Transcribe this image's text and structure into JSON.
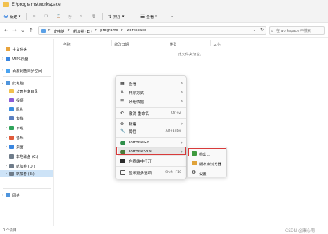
{
  "window": {
    "title": "E:\\programs\\workspace"
  },
  "toolbar": {
    "new_label": "新建",
    "sort_label": "排序",
    "view_label": "查看",
    "more_label": "···"
  },
  "address": {
    "crumbs": [
      "此电脑",
      "新加卷 (E:)",
      "programs",
      "workspace"
    ],
    "separator": ">",
    "search_placeholder": "在 workspace 中搜索"
  },
  "sidebar": {
    "items": [
      {
        "label": "主文件夹",
        "icon": "home-icon",
        "color": "#e8a33c"
      },
      {
        "label": "WPS云盘",
        "icon": "cloud-icon",
        "color": "#3a86e0"
      },
      {
        "label": "百度网盘同步空间",
        "icon": "cloud-icon",
        "color": "#4aa3f0"
      },
      {
        "label": "此电脑",
        "icon": "computer-icon",
        "color": "#4f95dd"
      },
      {
        "label": "公司共享目录",
        "icon": "folder-icon",
        "color": "#f2c14e"
      },
      {
        "label": "视频",
        "icon": "video-icon",
        "color": "#8a5cd6"
      },
      {
        "label": "图片",
        "icon": "picture-icon",
        "color": "#3a8ee0"
      },
      {
        "label": "文档",
        "icon": "document-icon",
        "color": "#5a7fbf"
      },
      {
        "label": "下载",
        "icon": "download-icon",
        "color": "#2fa35a"
      },
      {
        "label": "音乐",
        "icon": "music-icon",
        "color": "#e05a3a"
      },
      {
        "label": "桌面",
        "icon": "desktop-icon",
        "color": "#3a86e0"
      },
      {
        "label": "本地磁盘 (C:)",
        "icon": "drive-icon",
        "color": "#6f7c8a"
      },
      {
        "label": "新加卷 (D:)",
        "icon": "drive-icon",
        "color": "#6f7c8a"
      },
      {
        "label": "新加卷 (E:)",
        "icon": "drive-icon",
        "color": "#6f7c8a"
      },
      {
        "label": "网络",
        "icon": "network-icon",
        "color": "#4f95dd"
      }
    ]
  },
  "content": {
    "columns": [
      "名称",
      "修改日期",
      "类型",
      "大小"
    ],
    "empty_message": "此文件夹为空。"
  },
  "context_menu": {
    "items": [
      {
        "label": "查看",
        "icon": "view-icon",
        "shortcut": "",
        "submenu": true
      },
      {
        "label": "排序方式",
        "icon": "sort-icon",
        "shortcut": "",
        "submenu": true
      },
      {
        "label": "分组依据",
        "icon": "group-icon",
        "shortcut": "",
        "submenu": true
      },
      {
        "label": "撤消 重命名",
        "icon": "undo-icon",
        "shortcut": "Ctrl+Z",
        "submenu": false
      },
      {
        "label": "新建",
        "icon": "new-icon",
        "shortcut": "",
        "submenu": true
      },
      {
        "label": "属性",
        "icon": "properties-icon",
        "shortcut": "Alt+Enter",
        "submenu": false
      },
      {
        "label": "TortoiseGit",
        "icon": "tortoisegit-icon",
        "shortcut": "",
        "submenu": true
      },
      {
        "label": "TortoiseSVN",
        "icon": "tortoisesvn-icon",
        "shortcut": "",
        "submenu": true
      },
      {
        "label": "在终端中打开",
        "icon": "terminal-icon",
        "shortcut": "",
        "submenu": false
      },
      {
        "label": "显示更多选项",
        "icon": "more-options-icon",
        "shortcut": "Shift+F10",
        "submenu": false
      }
    ]
  },
  "svn_submenu": {
    "items": [
      {
        "label": "检出...",
        "icon": "checkout-icon"
      },
      {
        "label": "版本库浏览器",
        "icon": "repo-browser-icon"
      },
      {
        "label": "设置",
        "icon": "settings-icon"
      }
    ]
  },
  "status": {
    "count": "0 个项目",
    "watermark": "CSDN @康心雨"
  },
  "colors": {
    "accent": "#d83a3a",
    "selection": "#cde3f7"
  }
}
